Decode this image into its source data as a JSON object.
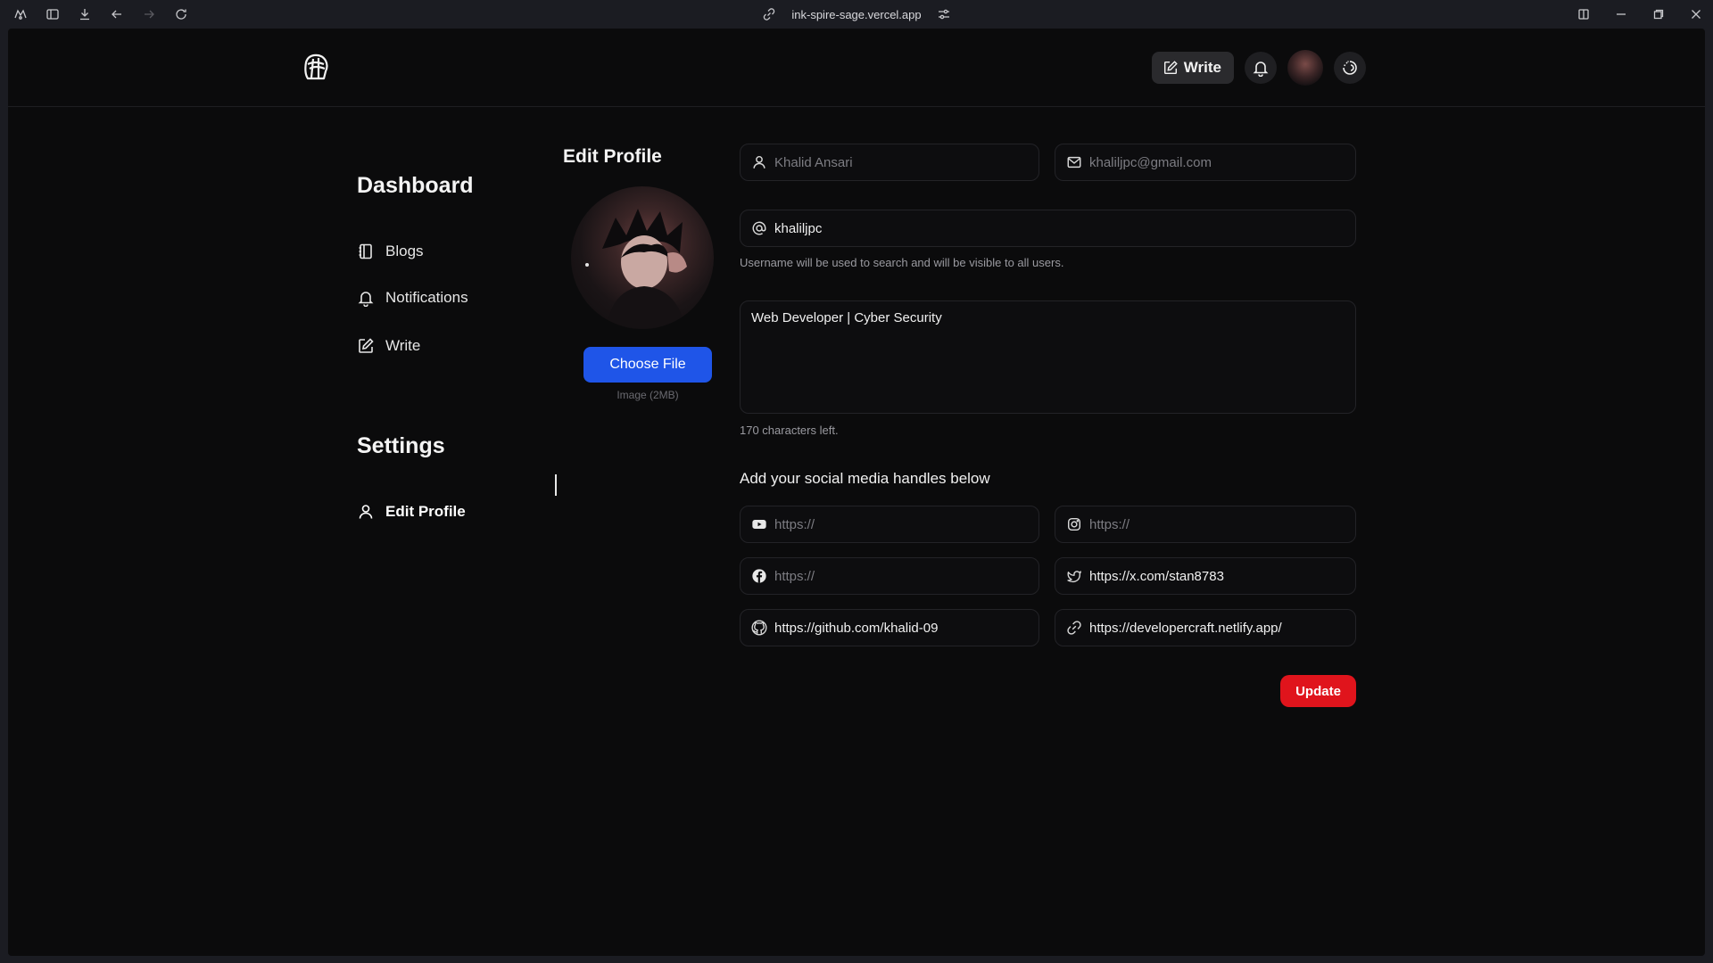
{
  "browser": {
    "url": "ink-spire-sage.vercel.app"
  },
  "nav": {
    "write_label": "Write"
  },
  "sidebar": {
    "dashboard_heading": "Dashboard",
    "dashboard_items": [
      {
        "label": "Blogs",
        "icon": "notebook-icon"
      },
      {
        "label": "Notifications",
        "icon": "bell-icon"
      },
      {
        "label": "Write",
        "icon": "edit-icon"
      }
    ],
    "settings_heading": "Settings",
    "settings_items": [
      {
        "label": "Edit Profile",
        "icon": "user-icon"
      }
    ]
  },
  "profile": {
    "title": "Edit Profile",
    "choose_file_label": "Choose File",
    "image_hint": "Image (2MB)"
  },
  "form": {
    "fullname": "Khalid Ansari",
    "email": "khaliljpc@gmail.com",
    "username": "khaliljpc",
    "username_help": "Username will be used to search and will be visible to all users.",
    "bio": "Web Developer | Cyber Security",
    "chars_left": "170 characters left.",
    "social_title": "Add your social media handles below",
    "social": {
      "youtube": "https://",
      "instagram": "https://",
      "facebook": "https://",
      "twitter": "https://x.com/stan8783",
      "github": "https://github.com/khalid-09",
      "website": "https://developercraft.netlify.app/"
    },
    "update_label": "Update"
  },
  "colors": {
    "accent_blue": "#1f55e8",
    "update_red": "#e0141c",
    "page_bg": "#0b0b0c"
  }
}
